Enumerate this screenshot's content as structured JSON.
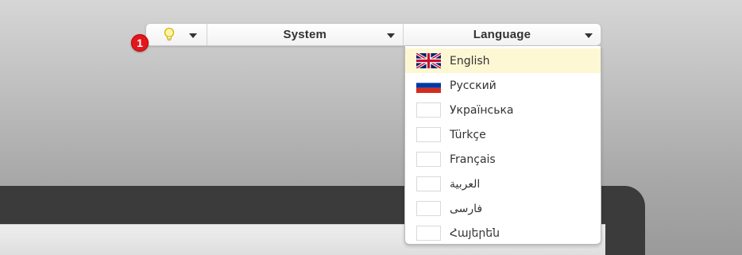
{
  "notification": {
    "count": "1",
    "icon": "lightbulb-icon"
  },
  "toolbar": {
    "system_label": "System",
    "language_label": "Language"
  },
  "languages": [
    {
      "label": "English",
      "flag": "uk-flag-icon",
      "selected": true
    },
    {
      "label": "Русский",
      "flag": "russia-flag-icon",
      "selected": false
    },
    {
      "label": "Українська",
      "flag": "blank-flag-icon",
      "selected": false
    },
    {
      "label": "Türkçe",
      "flag": "blank-flag-icon",
      "selected": false
    },
    {
      "label": "Français",
      "flag": "blank-flag-icon",
      "selected": false
    },
    {
      "label": "العربية",
      "flag": "blank-flag-icon",
      "selected": false
    },
    {
      "label": "فارسی",
      "flag": "blank-flag-icon",
      "selected": false
    },
    {
      "label": "Հայերեն",
      "flag": "blank-flag-icon",
      "selected": false
    }
  ],
  "colors": {
    "badge": "#e5161b",
    "selected_row": "#fdf7d4"
  }
}
